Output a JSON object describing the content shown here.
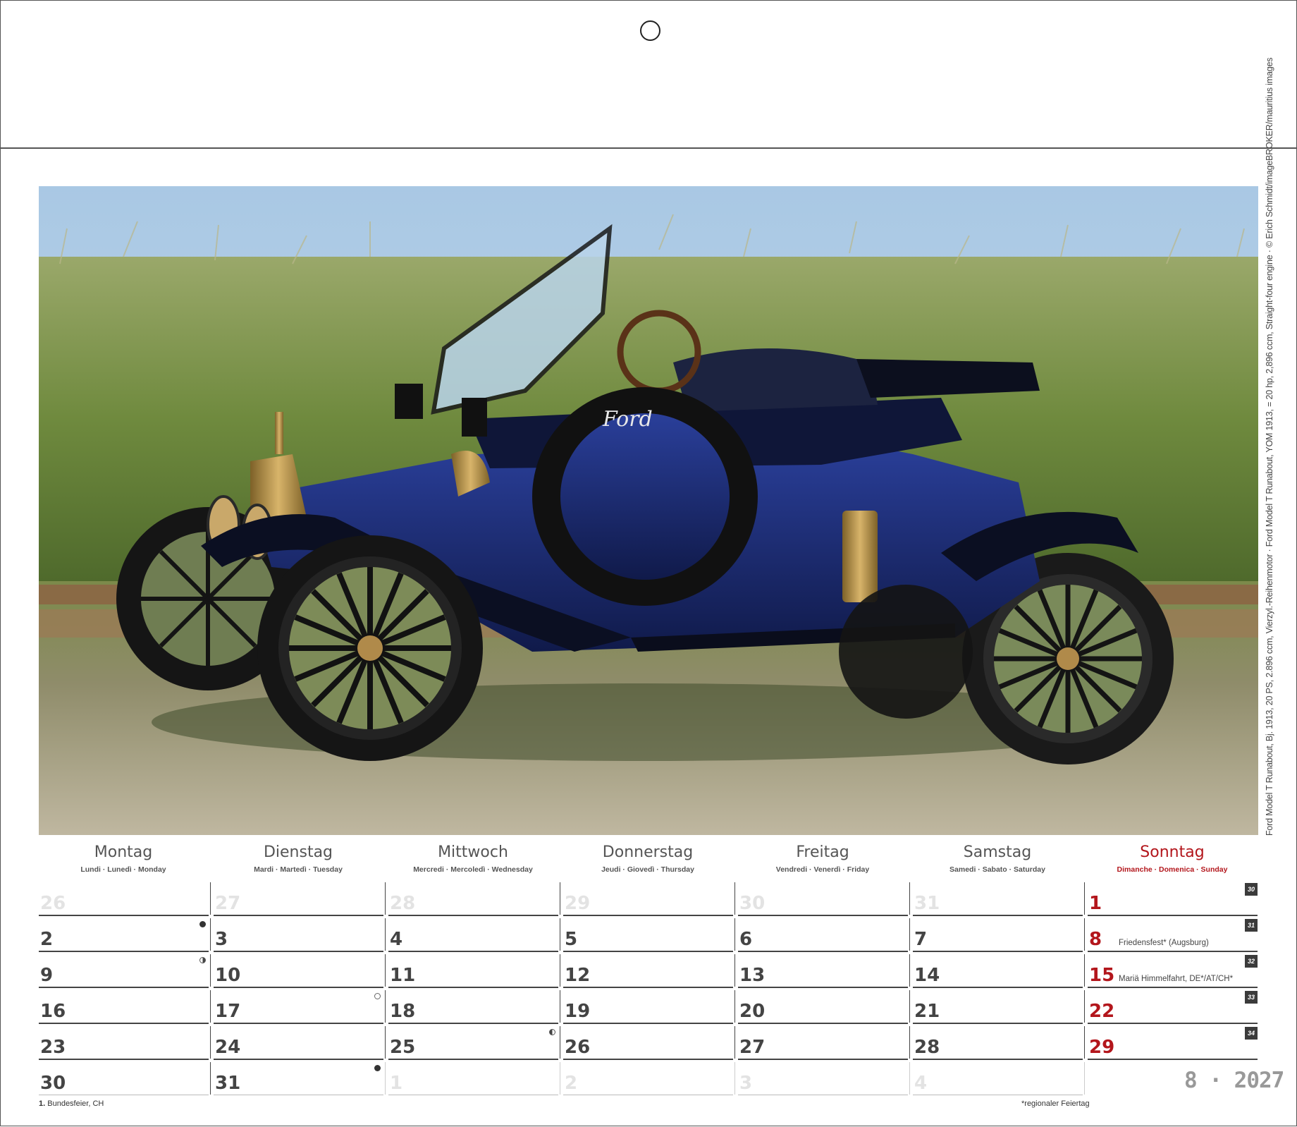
{
  "photo": {
    "credit": "Ford Model T Runabout, Bj. 1913, 20 PS, 2.896 ccm, Vierzyl.-Reihenmotor · Ford Model T Runabout, YOM 1913, = 20 hp, 2,896 ccm, Straight-four engine · © Erich Schmidt/imageBROKER/mauritius images",
    "badge": "Ford"
  },
  "weekdays": [
    {
      "name": "Montag",
      "sub": "Lundi · Lunedì · Monday"
    },
    {
      "name": "Dienstag",
      "sub": "Mardi · Martedì · Tuesday"
    },
    {
      "name": "Mittwoch",
      "sub": "Mercredi · Mercoledì · Wednesday"
    },
    {
      "name": "Donnerstag",
      "sub": "Jeudi · Giovedì · Thursday"
    },
    {
      "name": "Freitag",
      "sub": "Vendredi · Venerdì · Friday"
    },
    {
      "name": "Samstag",
      "sub": "Samedi · Sabato · Saturday"
    },
    {
      "name": "Sonntag",
      "sub": "Dimanche · Domenica · Sunday"
    }
  ],
  "weeks": [
    {
      "kw": "30",
      "days": [
        "26",
        "27",
        "28",
        "29",
        "30",
        "31",
        "1"
      ]
    },
    {
      "kw": "31",
      "days": [
        "2",
        "3",
        "4",
        "5",
        "6",
        "7",
        "8"
      ]
    },
    {
      "kw": "32",
      "days": [
        "9",
        "10",
        "11",
        "12",
        "13",
        "14",
        "15"
      ]
    },
    {
      "kw": "33",
      "days": [
        "16",
        "17",
        "18",
        "19",
        "20",
        "21",
        "22"
      ]
    },
    {
      "kw": "34",
      "days": [
        "23",
        "24",
        "25",
        "26",
        "27",
        "28",
        "29"
      ]
    },
    {
      "kw": "",
      "days": [
        "30",
        "31",
        "1",
        "2",
        "3",
        "4",
        ""
      ]
    }
  ],
  "holidays": {
    "w1_sun": "Friedensfest* (Augsburg)",
    "w2_sun": "Mariä Himmelfahrt, DE*/AT/CH*"
  },
  "month_year": "8 · 2027",
  "footer": {
    "left_num": "1.",
    "left_text": "Bundesfeier, CH",
    "right": "*regionaler Feiertag"
  },
  "colors": {
    "sunday": "#b3161c",
    "ghost_day": "#e3e3e3",
    "text": "#444444"
  }
}
